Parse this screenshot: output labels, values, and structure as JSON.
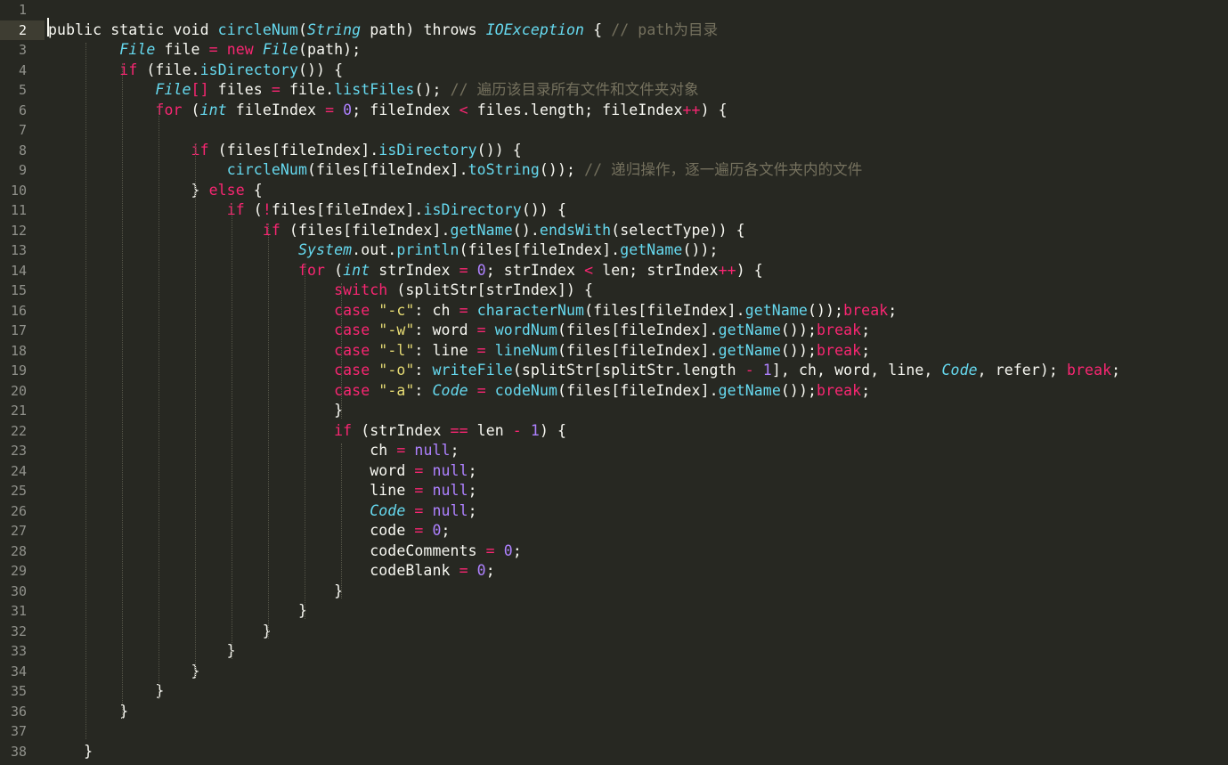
{
  "editor": {
    "current_line": 2,
    "line_numbers": [
      "1",
      "2",
      "3",
      "4",
      "5",
      "6",
      "7",
      "8",
      "9",
      "10",
      "11",
      "12",
      "13",
      "14",
      "15",
      "16",
      "17",
      "18",
      "19",
      "20",
      "21",
      "22",
      "23",
      "24",
      "25",
      "26",
      "27",
      "28",
      "29",
      "30",
      "31",
      "32",
      "33",
      "34",
      "35",
      "36",
      "37",
      "38"
    ],
    "lines": [
      [],
      [
        [
          "public static void ",
          "p"
        ],
        [
          "circleNum",
          "f"
        ],
        [
          "(",
          "p"
        ],
        [
          "String",
          "t"
        ],
        [
          " path) throws ",
          "p"
        ],
        [
          "IOException",
          "t"
        ],
        [
          " { ",
          "p"
        ],
        [
          "// path为目录",
          "c"
        ]
      ],
      [
        [
          "        ",
          "p"
        ],
        [
          "File",
          "t"
        ],
        [
          " file ",
          "p"
        ],
        [
          "=",
          "k"
        ],
        [
          " ",
          "p"
        ],
        [
          "new",
          "k"
        ],
        [
          " ",
          "p"
        ],
        [
          "File",
          "t"
        ],
        [
          "(path);",
          "p"
        ]
      ],
      [
        [
          "        ",
          "p"
        ],
        [
          "if",
          "k"
        ],
        [
          " (file.",
          "p"
        ],
        [
          "isDirectory",
          "f"
        ],
        [
          "()) {",
          "p"
        ]
      ],
      [
        [
          "            ",
          "p"
        ],
        [
          "File",
          "t"
        ],
        [
          "[]",
          "k"
        ],
        [
          " files ",
          "p"
        ],
        [
          "=",
          "k"
        ],
        [
          " file.",
          "p"
        ],
        [
          "listFiles",
          "f"
        ],
        [
          "(); ",
          "p"
        ],
        [
          "// 遍历该目录所有文件和文件夹对象",
          "c"
        ]
      ],
      [
        [
          "            ",
          "p"
        ],
        [
          "for",
          "k"
        ],
        [
          " (",
          "p"
        ],
        [
          "int",
          "t"
        ],
        [
          " fileIndex ",
          "p"
        ],
        [
          "=",
          "k"
        ],
        [
          " ",
          "p"
        ],
        [
          "0",
          "n"
        ],
        [
          "; fileIndex ",
          "p"
        ],
        [
          "<",
          "k"
        ],
        [
          " files.length; fileIndex",
          "p"
        ],
        [
          "++",
          "k"
        ],
        [
          ") {",
          "p"
        ]
      ],
      [],
      [
        [
          "                ",
          "p"
        ],
        [
          "if",
          "k"
        ],
        [
          " (files[fileIndex].",
          "p"
        ],
        [
          "isDirectory",
          "f"
        ],
        [
          "()) {",
          "p"
        ]
      ],
      [
        [
          "                    ",
          "p"
        ],
        [
          "circleNum",
          "f"
        ],
        [
          "(files[fileIndex].",
          "p"
        ],
        [
          "toString",
          "f"
        ],
        [
          "()); ",
          "p"
        ],
        [
          "// 递归操作，逐一遍历各文件夹内的文件",
          "c"
        ]
      ],
      [
        [
          "                } ",
          "p"
        ],
        [
          "else",
          "k"
        ],
        [
          " {",
          "p"
        ]
      ],
      [
        [
          "                    ",
          "p"
        ],
        [
          "if",
          "k"
        ],
        [
          " (",
          "p"
        ],
        [
          "!",
          "k"
        ],
        [
          "files[fileIndex].",
          "p"
        ],
        [
          "isDirectory",
          "f"
        ],
        [
          "()) {",
          "p"
        ]
      ],
      [
        [
          "                        ",
          "p"
        ],
        [
          "if",
          "k"
        ],
        [
          " (files[fileIndex].",
          "p"
        ],
        [
          "getName",
          "f"
        ],
        [
          "().",
          "p"
        ],
        [
          "endsWith",
          "f"
        ],
        [
          "(selectType)) {",
          "p"
        ]
      ],
      [
        [
          "                            ",
          "p"
        ],
        [
          "System",
          "t"
        ],
        [
          ".out.",
          "p"
        ],
        [
          "println",
          "f"
        ],
        [
          "(files[fileIndex].",
          "p"
        ],
        [
          "getName",
          "f"
        ],
        [
          "());",
          "p"
        ]
      ],
      [
        [
          "                            ",
          "p"
        ],
        [
          "for",
          "k"
        ],
        [
          " (",
          "p"
        ],
        [
          "int",
          "t"
        ],
        [
          " strIndex ",
          "p"
        ],
        [
          "=",
          "k"
        ],
        [
          " ",
          "p"
        ],
        [
          "0",
          "n"
        ],
        [
          "; strIndex ",
          "p"
        ],
        [
          "<",
          "k"
        ],
        [
          " len; strIndex",
          "p"
        ],
        [
          "++",
          "k"
        ],
        [
          ") {",
          "p"
        ]
      ],
      [
        [
          "                                ",
          "p"
        ],
        [
          "switch",
          "k"
        ],
        [
          " (splitStr[strIndex]) {",
          "p"
        ]
      ],
      [
        [
          "                                ",
          "p"
        ],
        [
          "case",
          "k"
        ],
        [
          " ",
          "p"
        ],
        [
          "\"-c\"",
          "s"
        ],
        [
          ": ch ",
          "p"
        ],
        [
          "=",
          "k"
        ],
        [
          " ",
          "p"
        ],
        [
          "characterNum",
          "f"
        ],
        [
          "(files[fileIndex].",
          "p"
        ],
        [
          "getName",
          "f"
        ],
        [
          "());",
          "p"
        ],
        [
          "break",
          "k"
        ],
        [
          ";",
          "p"
        ]
      ],
      [
        [
          "                                ",
          "p"
        ],
        [
          "case",
          "k"
        ],
        [
          " ",
          "p"
        ],
        [
          "\"-w\"",
          "s"
        ],
        [
          ": word ",
          "p"
        ],
        [
          "=",
          "k"
        ],
        [
          " ",
          "p"
        ],
        [
          "wordNum",
          "f"
        ],
        [
          "(files[fileIndex].",
          "p"
        ],
        [
          "getName",
          "f"
        ],
        [
          "());",
          "p"
        ],
        [
          "break",
          "k"
        ],
        [
          ";",
          "p"
        ]
      ],
      [
        [
          "                                ",
          "p"
        ],
        [
          "case",
          "k"
        ],
        [
          " ",
          "p"
        ],
        [
          "\"-l\"",
          "s"
        ],
        [
          ": line ",
          "p"
        ],
        [
          "=",
          "k"
        ],
        [
          " ",
          "p"
        ],
        [
          "lineNum",
          "f"
        ],
        [
          "(files[fileIndex].",
          "p"
        ],
        [
          "getName",
          "f"
        ],
        [
          "());",
          "p"
        ],
        [
          "break",
          "k"
        ],
        [
          ";",
          "p"
        ]
      ],
      [
        [
          "                                ",
          "p"
        ],
        [
          "case",
          "k"
        ],
        [
          " ",
          "p"
        ],
        [
          "\"-o\"",
          "s"
        ],
        [
          ": ",
          "p"
        ],
        [
          "writeFile",
          "f"
        ],
        [
          "(splitStr[splitStr.length ",
          "p"
        ],
        [
          "-",
          "k"
        ],
        [
          " ",
          "p"
        ],
        [
          "1",
          "n"
        ],
        [
          "], ch, word, line, ",
          "p"
        ],
        [
          "Code",
          "t"
        ],
        [
          ", refer); ",
          "p"
        ],
        [
          "break",
          "k"
        ],
        [
          ";",
          "p"
        ]
      ],
      [
        [
          "                                ",
          "p"
        ],
        [
          "case",
          "k"
        ],
        [
          " ",
          "p"
        ],
        [
          "\"-a\"",
          "s"
        ],
        [
          ": ",
          "p"
        ],
        [
          "Code",
          "t"
        ],
        [
          " ",
          "p"
        ],
        [
          "=",
          "k"
        ],
        [
          " ",
          "p"
        ],
        [
          "codeNum",
          "f"
        ],
        [
          "(files[fileIndex].",
          "p"
        ],
        [
          "getName",
          "f"
        ],
        [
          "());",
          "p"
        ],
        [
          "break",
          "k"
        ],
        [
          ";",
          "p"
        ]
      ],
      [
        [
          "                                }",
          "p"
        ]
      ],
      [
        [
          "                                ",
          "p"
        ],
        [
          "if",
          "k"
        ],
        [
          " (strIndex ",
          "p"
        ],
        [
          "==",
          "k"
        ],
        [
          " len ",
          "p"
        ],
        [
          "-",
          "k"
        ],
        [
          " ",
          "p"
        ],
        [
          "1",
          "n"
        ],
        [
          ") {",
          "p"
        ]
      ],
      [
        [
          "                                    ch ",
          "p"
        ],
        [
          "=",
          "k"
        ],
        [
          " ",
          "p"
        ],
        [
          "null",
          "n"
        ],
        [
          ";",
          "p"
        ]
      ],
      [
        [
          "                                    word ",
          "p"
        ],
        [
          "=",
          "k"
        ],
        [
          " ",
          "p"
        ],
        [
          "null",
          "n"
        ],
        [
          ";",
          "p"
        ]
      ],
      [
        [
          "                                    line ",
          "p"
        ],
        [
          "=",
          "k"
        ],
        [
          " ",
          "p"
        ],
        [
          "null",
          "n"
        ],
        [
          ";",
          "p"
        ]
      ],
      [
        [
          "                                    ",
          "p"
        ],
        [
          "Code",
          "t"
        ],
        [
          " ",
          "p"
        ],
        [
          "=",
          "k"
        ],
        [
          " ",
          "p"
        ],
        [
          "null",
          "n"
        ],
        [
          ";",
          "p"
        ]
      ],
      [
        [
          "                                    code ",
          "p"
        ],
        [
          "=",
          "k"
        ],
        [
          " ",
          "p"
        ],
        [
          "0",
          "n"
        ],
        [
          ";",
          "p"
        ]
      ],
      [
        [
          "                                    codeComments ",
          "p"
        ],
        [
          "=",
          "k"
        ],
        [
          " ",
          "p"
        ],
        [
          "0",
          "n"
        ],
        [
          ";",
          "p"
        ]
      ],
      [
        [
          "                                    codeBlank ",
          "p"
        ],
        [
          "=",
          "k"
        ],
        [
          " ",
          "p"
        ],
        [
          "0",
          "n"
        ],
        [
          ";",
          "p"
        ]
      ],
      [
        [
          "                                }",
          "p"
        ]
      ],
      [
        [
          "                            }",
          "p"
        ]
      ],
      [
        [
          "                        }",
          "p"
        ]
      ],
      [
        [
          "                    }",
          "p"
        ]
      ],
      [
        [
          "                }",
          "p"
        ]
      ],
      [
        [
          "            }",
          "p"
        ]
      ],
      [
        [
          "        }",
          "p"
        ]
      ],
      [],
      [
        [
          "    }",
          "p"
        ]
      ]
    ]
  }
}
